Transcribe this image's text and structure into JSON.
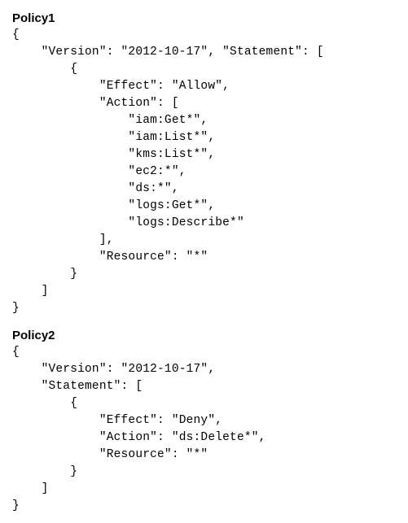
{
  "policy1": {
    "title": "Policy1",
    "code": "{\n    \"Version\": \"2012-10-17\", \"Statement\": [\n        {\n            \"Effect\": \"Allow\",\n            \"Action\": [\n                \"iam:Get*\",\n                \"iam:List*\",\n                \"kms:List*\",\n                \"ec2:*\",\n                \"ds:*\",\n                \"logs:Get*\",\n                \"logs:Describe*\"\n            ],\n            \"Resource\": \"*\"\n        }\n    ]\n}"
  },
  "policy2": {
    "title": "Policy2",
    "code": "{\n    \"Version\": \"2012-10-17\",\n    \"Statement\": [\n        {\n            \"Effect\": \"Deny\",\n            \"Action\": \"ds:Delete*\",\n            \"Resource\": \"*\"\n        }\n    ]\n}"
  }
}
